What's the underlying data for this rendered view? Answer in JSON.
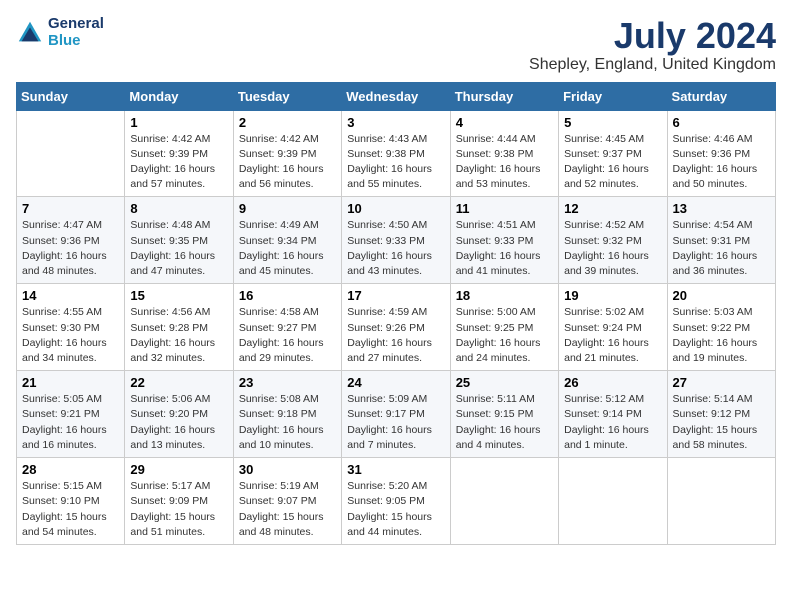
{
  "header": {
    "logo_line1": "General",
    "logo_line2": "Blue",
    "main_title": "July 2024",
    "subtitle": "Shepley, England, United Kingdom"
  },
  "days_of_week": [
    "Sunday",
    "Monday",
    "Tuesday",
    "Wednesday",
    "Thursday",
    "Friday",
    "Saturday"
  ],
  "weeks": [
    [
      {
        "number": "",
        "info": ""
      },
      {
        "number": "1",
        "info": "Sunrise: 4:42 AM\nSunset: 9:39 PM\nDaylight: 16 hours and 57 minutes."
      },
      {
        "number": "2",
        "info": "Sunrise: 4:42 AM\nSunset: 9:39 PM\nDaylight: 16 hours and 56 minutes."
      },
      {
        "number": "3",
        "info": "Sunrise: 4:43 AM\nSunset: 9:38 PM\nDaylight: 16 hours and 55 minutes."
      },
      {
        "number": "4",
        "info": "Sunrise: 4:44 AM\nSunset: 9:38 PM\nDaylight: 16 hours and 53 minutes."
      },
      {
        "number": "5",
        "info": "Sunrise: 4:45 AM\nSunset: 9:37 PM\nDaylight: 16 hours and 52 minutes."
      },
      {
        "number": "6",
        "info": "Sunrise: 4:46 AM\nSunset: 9:36 PM\nDaylight: 16 hours and 50 minutes."
      }
    ],
    [
      {
        "number": "7",
        "info": "Sunrise: 4:47 AM\nSunset: 9:36 PM\nDaylight: 16 hours and 48 minutes."
      },
      {
        "number": "8",
        "info": "Sunrise: 4:48 AM\nSunset: 9:35 PM\nDaylight: 16 hours and 47 minutes."
      },
      {
        "number": "9",
        "info": "Sunrise: 4:49 AM\nSunset: 9:34 PM\nDaylight: 16 hours and 45 minutes."
      },
      {
        "number": "10",
        "info": "Sunrise: 4:50 AM\nSunset: 9:33 PM\nDaylight: 16 hours and 43 minutes."
      },
      {
        "number": "11",
        "info": "Sunrise: 4:51 AM\nSunset: 9:33 PM\nDaylight: 16 hours and 41 minutes."
      },
      {
        "number": "12",
        "info": "Sunrise: 4:52 AM\nSunset: 9:32 PM\nDaylight: 16 hours and 39 minutes."
      },
      {
        "number": "13",
        "info": "Sunrise: 4:54 AM\nSunset: 9:31 PM\nDaylight: 16 hours and 36 minutes."
      }
    ],
    [
      {
        "number": "14",
        "info": "Sunrise: 4:55 AM\nSunset: 9:30 PM\nDaylight: 16 hours and 34 minutes."
      },
      {
        "number": "15",
        "info": "Sunrise: 4:56 AM\nSunset: 9:28 PM\nDaylight: 16 hours and 32 minutes."
      },
      {
        "number": "16",
        "info": "Sunrise: 4:58 AM\nSunset: 9:27 PM\nDaylight: 16 hours and 29 minutes."
      },
      {
        "number": "17",
        "info": "Sunrise: 4:59 AM\nSunset: 9:26 PM\nDaylight: 16 hours and 27 minutes."
      },
      {
        "number": "18",
        "info": "Sunrise: 5:00 AM\nSunset: 9:25 PM\nDaylight: 16 hours and 24 minutes."
      },
      {
        "number": "19",
        "info": "Sunrise: 5:02 AM\nSunset: 9:24 PM\nDaylight: 16 hours and 21 minutes."
      },
      {
        "number": "20",
        "info": "Sunrise: 5:03 AM\nSunset: 9:22 PM\nDaylight: 16 hours and 19 minutes."
      }
    ],
    [
      {
        "number": "21",
        "info": "Sunrise: 5:05 AM\nSunset: 9:21 PM\nDaylight: 16 hours and 16 minutes."
      },
      {
        "number": "22",
        "info": "Sunrise: 5:06 AM\nSunset: 9:20 PM\nDaylight: 16 hours and 13 minutes."
      },
      {
        "number": "23",
        "info": "Sunrise: 5:08 AM\nSunset: 9:18 PM\nDaylight: 16 hours and 10 minutes."
      },
      {
        "number": "24",
        "info": "Sunrise: 5:09 AM\nSunset: 9:17 PM\nDaylight: 16 hours and 7 minutes."
      },
      {
        "number": "25",
        "info": "Sunrise: 5:11 AM\nSunset: 9:15 PM\nDaylight: 16 hours and 4 minutes."
      },
      {
        "number": "26",
        "info": "Sunrise: 5:12 AM\nSunset: 9:14 PM\nDaylight: 16 hours and 1 minute."
      },
      {
        "number": "27",
        "info": "Sunrise: 5:14 AM\nSunset: 9:12 PM\nDaylight: 15 hours and 58 minutes."
      }
    ],
    [
      {
        "number": "28",
        "info": "Sunrise: 5:15 AM\nSunset: 9:10 PM\nDaylight: 15 hours and 54 minutes."
      },
      {
        "number": "29",
        "info": "Sunrise: 5:17 AM\nSunset: 9:09 PM\nDaylight: 15 hours and 51 minutes."
      },
      {
        "number": "30",
        "info": "Sunrise: 5:19 AM\nSunset: 9:07 PM\nDaylight: 15 hours and 48 minutes."
      },
      {
        "number": "31",
        "info": "Sunrise: 5:20 AM\nSunset: 9:05 PM\nDaylight: 15 hours and 44 minutes."
      },
      {
        "number": "",
        "info": ""
      },
      {
        "number": "",
        "info": ""
      },
      {
        "number": "",
        "info": ""
      }
    ]
  ]
}
